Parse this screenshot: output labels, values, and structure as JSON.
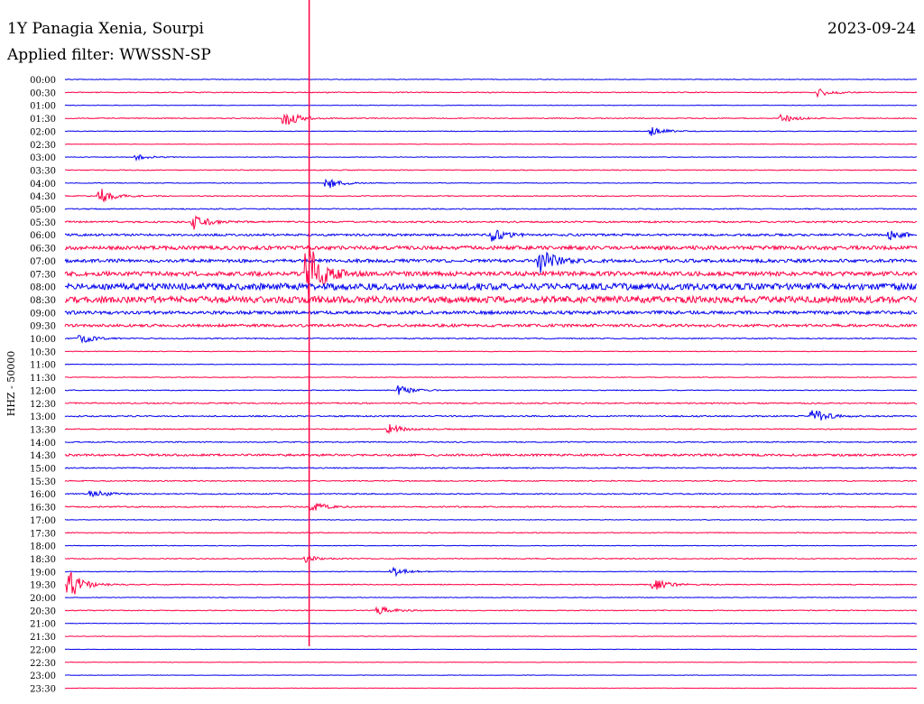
{
  "header": {
    "station": "1Y Panagia Xenia, Sourpi",
    "date": "2023-09-24",
    "filter_label": "Applied filter: WWSSN-SP"
  },
  "y_axis_label": "HHZ - 50000",
  "colors": {
    "even_trace": "#0000ee",
    "odd_trace": "#ff0044",
    "event_line": "#ff0044",
    "background": "#ffffff"
  },
  "chart_data": {
    "type": "line",
    "title": "1Y Panagia Xenia, Sourpi",
    "channel": "HHZ - 50000",
    "filter": "WWSSN-SP",
    "rows": [
      "00:00",
      "00:30",
      "01:00",
      "01:30",
      "02:00",
      "02:30",
      "03:00",
      "03:30",
      "04:00",
      "04:30",
      "05:00",
      "05:30",
      "06:00",
      "06:30",
      "07:00",
      "07:30",
      "08:00",
      "08:30",
      "09:00",
      "09:30",
      "10:00",
      "10:30",
      "11:00",
      "11:30",
      "12:00",
      "12:30",
      "13:00",
      "13:30",
      "14:00",
      "14:30",
      "15:00",
      "15:30",
      "16:00",
      "16:30",
      "17:00",
      "17:30",
      "18:00",
      "18:30",
      "19:00",
      "19:30",
      "20:00",
      "20:30",
      "21:00",
      "21:30",
      "22:00",
      "22:30",
      "23:00",
      "23:30"
    ],
    "row_minutes": 30,
    "noise_level": [
      0.06,
      0.08,
      0.05,
      0.08,
      0.06,
      0.05,
      0.05,
      0.08,
      0.06,
      0.08,
      0.1,
      0.15,
      0.2,
      0.35,
      0.3,
      0.4,
      0.6,
      0.6,
      0.3,
      0.25,
      0.1,
      0.06,
      0.06,
      0.06,
      0.08,
      0.12,
      0.12,
      0.1,
      0.1,
      0.2,
      0.1,
      0.1,
      0.1,
      0.12,
      0.06,
      0.08,
      0.06,
      0.08,
      0.06,
      0.08,
      0.06,
      0.08,
      0.05,
      0.05,
      0.04,
      0.05,
      0.04,
      0.04
    ],
    "events": [
      {
        "row": 1,
        "minute": 26.5,
        "amplitude": 0.8
      },
      {
        "row": 3,
        "minute": 7.7,
        "amplitude": 1.8
      },
      {
        "row": 3,
        "minute": 25.2,
        "amplitude": 0.9
      },
      {
        "row": 4,
        "minute": 20.6,
        "amplitude": 1.0
      },
      {
        "row": 6,
        "minute": 2.5,
        "amplitude": 0.5
      },
      {
        "row": 8,
        "minute": 9.2,
        "amplitude": 1.2
      },
      {
        "row": 9,
        "minute": 1.2,
        "amplitude": 1.6
      },
      {
        "row": 11,
        "minute": 4.5,
        "amplitude": 1.4
      },
      {
        "row": 12,
        "minute": 15.0,
        "amplitude": 1.2
      },
      {
        "row": 12,
        "minute": 29.0,
        "amplitude": 1.0
      },
      {
        "row": 14,
        "minute": 16.7,
        "amplitude": 2.5
      },
      {
        "row": 15,
        "minute": 8.5,
        "amplitude": 7.0
      },
      {
        "row": 20,
        "minute": 0.5,
        "amplitude": 1.0
      },
      {
        "row": 24,
        "minute": 11.7,
        "amplitude": 1.0
      },
      {
        "row": 26,
        "minute": 26.3,
        "amplitude": 1.5
      },
      {
        "row": 27,
        "minute": 11.4,
        "amplitude": 1.0
      },
      {
        "row": 32,
        "minute": 0.9,
        "amplitude": 1.0
      },
      {
        "row": 33,
        "minute": 8.7,
        "amplitude": 0.9
      },
      {
        "row": 37,
        "minute": 8.4,
        "amplitude": 0.8
      },
      {
        "row": 38,
        "minute": 11.5,
        "amplitude": 1.0
      },
      {
        "row": 39,
        "minute": 0.1,
        "amplitude": 3.0
      },
      {
        "row": 39,
        "minute": 20.7,
        "amplitude": 1.4
      },
      {
        "row": 41,
        "minute": 11.0,
        "amplitude": 1.0
      }
    ],
    "marker_minute": 8.6,
    "x_range": [
      0,
      30
    ],
    "grid": false,
    "legend": "none"
  }
}
